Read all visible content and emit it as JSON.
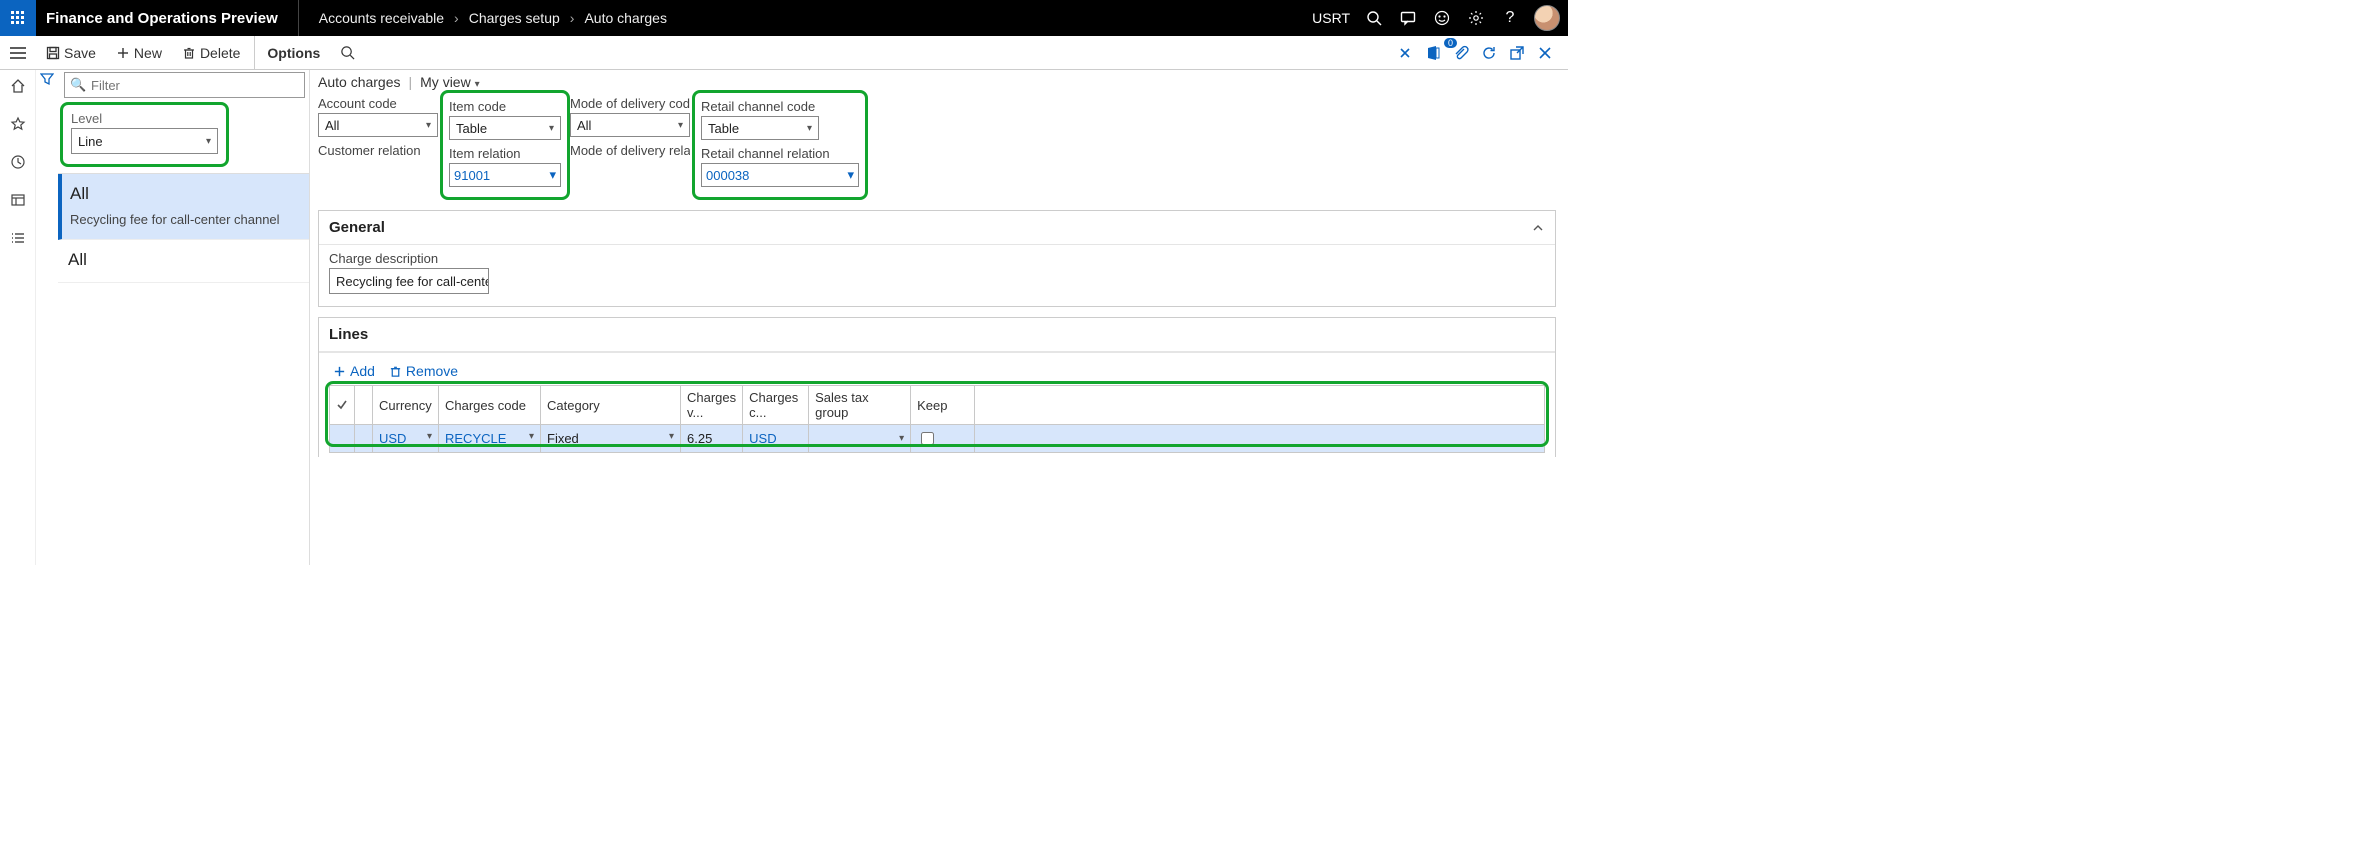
{
  "header": {
    "app_title": "Finance and Operations Preview",
    "breadcrumb": [
      "Accounts receivable",
      "Charges setup",
      "Auto charges"
    ],
    "company": "USRT"
  },
  "actions": {
    "save": "Save",
    "new": "New",
    "delete": "Delete",
    "options": "Options"
  },
  "left": {
    "filter_placeholder": "Filter",
    "level_label": "Level",
    "level_value": "Line",
    "items": [
      {
        "title": "All",
        "subtitle": "Recycling fee for call-center channel",
        "selected": true
      },
      {
        "title": "All",
        "subtitle": "",
        "selected": false
      }
    ]
  },
  "main": {
    "title": "Auto charges",
    "view_label": "My view",
    "fields": {
      "account_code": {
        "label": "Account code",
        "value": "All"
      },
      "item_code": {
        "label": "Item code",
        "value": "Table"
      },
      "mode_code": {
        "label": "Mode of delivery code",
        "value": "All"
      },
      "retail_code": {
        "label": "Retail channel code",
        "value": "Table"
      },
      "customer_rel": {
        "label": "Customer relation",
        "value": ""
      },
      "item_rel": {
        "label": "Item relation",
        "value": "91001"
      },
      "mode_rel": {
        "label": "Mode of delivery relation",
        "value": ""
      },
      "retail_rel": {
        "label": "Retail channel relation",
        "value": "000038"
      }
    },
    "general": {
      "title": "General",
      "desc_label": "Charge description",
      "desc_value": "Recycling fee for call-center c..."
    },
    "lines": {
      "title": "Lines",
      "add": "Add",
      "remove": "Remove",
      "columns": [
        "Currency",
        "Charges code",
        "Category",
        "Charges v...",
        "Charges c...",
        "Sales tax group",
        "Keep"
      ],
      "row": {
        "currency": "USD",
        "charges_code": "RECYCLE",
        "category": "Fixed",
        "charges_value": "6.25",
        "charges_currency": "USD",
        "sales_tax": "",
        "keep": false
      }
    }
  }
}
